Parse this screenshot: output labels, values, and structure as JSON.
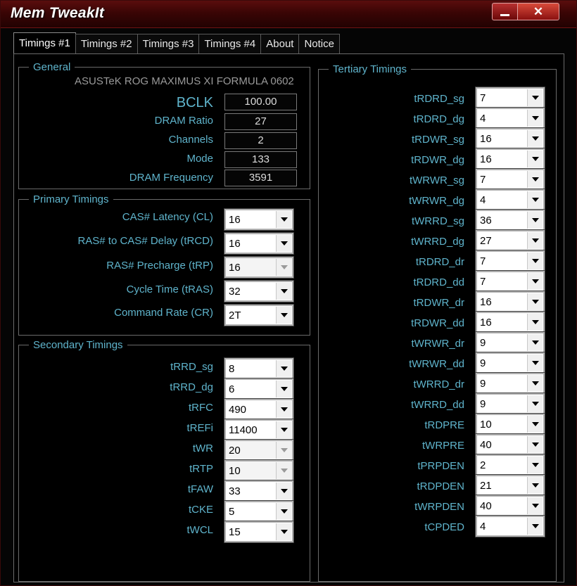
{
  "window": {
    "title": "Mem TweakIt",
    "minimize_icon": "minimize-icon",
    "close_glyph": "✕"
  },
  "tabs": [
    {
      "label": "Timings #1"
    },
    {
      "label": "Timings #2"
    },
    {
      "label": "Timings #3"
    },
    {
      "label": "Timings #4"
    },
    {
      "label": "About"
    },
    {
      "label": "Notice"
    }
  ],
  "general": {
    "legend": "General",
    "motherboard": "ASUSTeK ROG MAXIMUS XI FORMULA 0602",
    "fields": [
      {
        "label": "BCLK",
        "value": "100.00"
      },
      {
        "label": "DRAM Ratio",
        "value": "27"
      },
      {
        "label": "Channels",
        "value": "2"
      },
      {
        "label": "Mode",
        "value": "133"
      },
      {
        "label": "DRAM Frequency",
        "value": "3591"
      }
    ]
  },
  "primary": {
    "legend": "Primary Timings",
    "fields": [
      {
        "label": "CAS# Latency (CL)",
        "value": "16",
        "enabled": true
      },
      {
        "label": "RAS# to CAS# Delay (tRCD)",
        "value": "16",
        "enabled": true
      },
      {
        "label": "RAS# Precharge (tRP)",
        "value": "16",
        "enabled": false
      },
      {
        "label": "Cycle Time (tRAS)",
        "value": "32",
        "enabled": true
      },
      {
        "label": "Command Rate (CR)",
        "value": "2T",
        "enabled": true
      }
    ]
  },
  "secondary": {
    "legend": "Secondary Timings",
    "fields": [
      {
        "label": "tRRD_sg",
        "value": "8",
        "enabled": true
      },
      {
        "label": "tRRD_dg",
        "value": "6",
        "enabled": true
      },
      {
        "label": "tRFC",
        "value": "490",
        "enabled": true
      },
      {
        "label": "tREFi",
        "value": "11400",
        "enabled": true
      },
      {
        "label": "tWR",
        "value": "20",
        "enabled": false
      },
      {
        "label": "tRTP",
        "value": "10",
        "enabled": false
      },
      {
        "label": "tFAW",
        "value": "33",
        "enabled": true
      },
      {
        "label": "tCKE",
        "value": "5",
        "enabled": true
      },
      {
        "label": "tWCL",
        "value": "15",
        "enabled": true
      }
    ]
  },
  "tertiary": {
    "legend": "Tertiary Timings",
    "fields": [
      {
        "label": "tRDRD_sg",
        "value": "7"
      },
      {
        "label": "tRDRD_dg",
        "value": "4"
      },
      {
        "label": "tRDWR_sg",
        "value": "16"
      },
      {
        "label": "tRDWR_dg",
        "value": "16"
      },
      {
        "label": "tWRWR_sg",
        "value": "7"
      },
      {
        "label": "tWRWR_dg",
        "value": "4"
      },
      {
        "label": "tWRRD_sg",
        "value": "36"
      },
      {
        "label": "tWRRD_dg",
        "value": "27"
      },
      {
        "label": "tRDRD_dr",
        "value": "7"
      },
      {
        "label": "tRDRD_dd",
        "value": "7"
      },
      {
        "label": "tRDWR_dr",
        "value": "16"
      },
      {
        "label": "tRDWR_dd",
        "value": "16"
      },
      {
        "label": "tWRWR_dr",
        "value": "9"
      },
      {
        "label": "tWRWR_dd",
        "value": "9"
      },
      {
        "label": "tWRRD_dr",
        "value": "9"
      },
      {
        "label": "tWRRD_dd",
        "value": "9"
      },
      {
        "label": "tRDPRE",
        "value": "10"
      },
      {
        "label": "tWRPRE",
        "value": "40"
      },
      {
        "label": "tPRPDEN",
        "value": "2"
      },
      {
        "label": "tRDPDEN",
        "value": "21"
      },
      {
        "label": "tWRPDEN",
        "value": "40"
      },
      {
        "label": "tCPDED",
        "value": "4"
      }
    ]
  },
  "colors": {
    "label": "#5fb4cc",
    "title_bar": "#3a0505",
    "background": "#000000"
  }
}
